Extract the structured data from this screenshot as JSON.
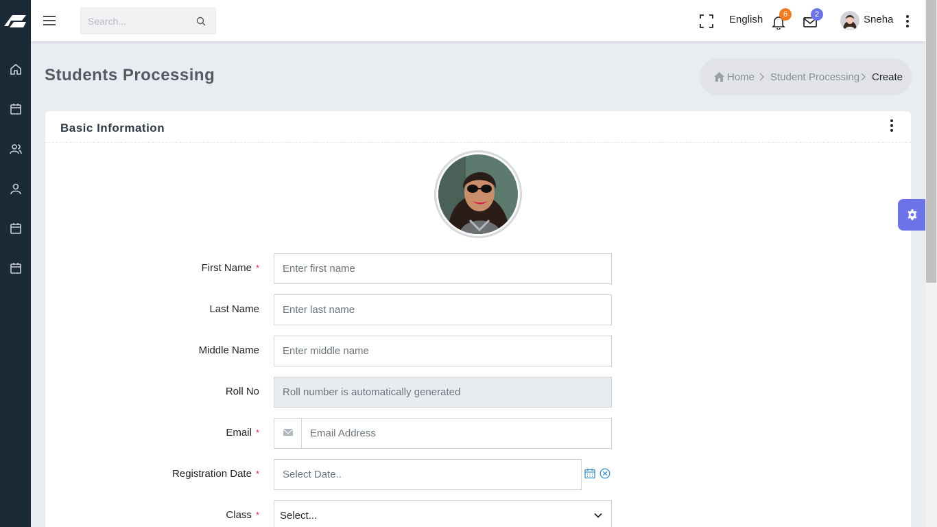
{
  "topbar": {
    "search_placeholder": "Search...",
    "language": "English",
    "notifications_count": "6",
    "messages_count": "2",
    "user_name": "Sneha"
  },
  "sidebar": {
    "items": [
      "home-icon",
      "calendar-icon",
      "users-icon",
      "user-icon",
      "calendar-icon",
      "calendar-icon"
    ]
  },
  "page": {
    "title": "Students Processing",
    "breadcrumb": [
      "Home",
      "Student Processing",
      "Create"
    ]
  },
  "card": {
    "title": "Basic Information"
  },
  "form": {
    "first_name": {
      "label": "First Name",
      "required": "*",
      "placeholder": "Enter first name"
    },
    "last_name": {
      "label": "Last Name",
      "placeholder": "Enter last name"
    },
    "middle_name": {
      "label": "Middle Name",
      "placeholder": "Enter middle name"
    },
    "roll_no": {
      "label": "Roll No",
      "placeholder": "Roll number is automatically generated"
    },
    "email": {
      "label": "Email",
      "required": "*",
      "placeholder": "Email Address"
    },
    "registration_date": {
      "label": "Registration Date",
      "required": "*",
      "placeholder": "Select Date.."
    },
    "class": {
      "label": "Class",
      "required": "*",
      "value": "Select..."
    }
  },
  "colors": {
    "sidebar": "#1c2a38",
    "accent": "#6c73e8",
    "badge_orange": "#f47b20",
    "required": "#d9343f"
  }
}
